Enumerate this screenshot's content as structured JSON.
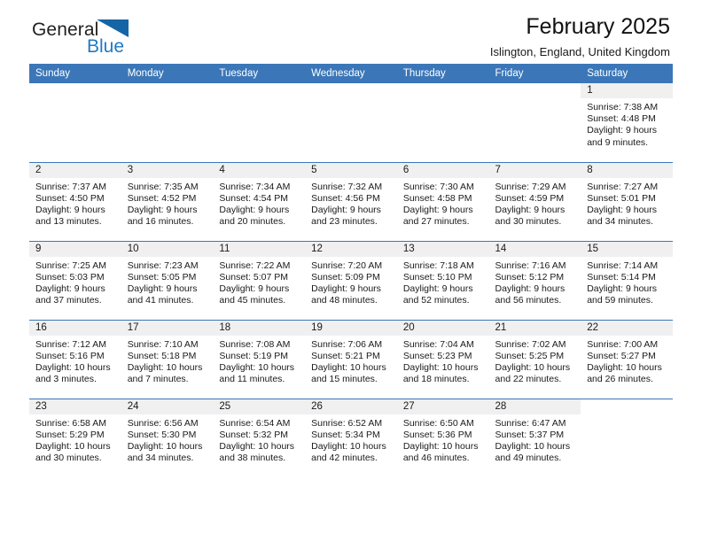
{
  "brand": {
    "name_part1": "General",
    "name_part2": "Blue",
    "logo_icon": "triangle-flag-icon",
    "accent_color": "#1f7ac4",
    "flag_color": "#1565a6"
  },
  "header": {
    "title": "February 2025",
    "subtitle": "Islington, England, United Kingdom"
  },
  "calendar": {
    "header_bg": "#3b77b8",
    "daynum_bg": "#f0f0f0",
    "weekdays": [
      "Sunday",
      "Monday",
      "Tuesday",
      "Wednesday",
      "Thursday",
      "Friday",
      "Saturday"
    ],
    "weeks": [
      [
        {
          "day": "",
          "sunrise": "",
          "sunset": "",
          "daylight": ""
        },
        {
          "day": "",
          "sunrise": "",
          "sunset": "",
          "daylight": ""
        },
        {
          "day": "",
          "sunrise": "",
          "sunset": "",
          "daylight": ""
        },
        {
          "day": "",
          "sunrise": "",
          "sunset": "",
          "daylight": ""
        },
        {
          "day": "",
          "sunrise": "",
          "sunset": "",
          "daylight": ""
        },
        {
          "day": "",
          "sunrise": "",
          "sunset": "",
          "daylight": ""
        },
        {
          "day": "1",
          "sunrise": "Sunrise: 7:38 AM",
          "sunset": "Sunset: 4:48 PM",
          "daylight": "Daylight: 9 hours and 9 minutes."
        }
      ],
      [
        {
          "day": "2",
          "sunrise": "Sunrise: 7:37 AM",
          "sunset": "Sunset: 4:50 PM",
          "daylight": "Daylight: 9 hours and 13 minutes."
        },
        {
          "day": "3",
          "sunrise": "Sunrise: 7:35 AM",
          "sunset": "Sunset: 4:52 PM",
          "daylight": "Daylight: 9 hours and 16 minutes."
        },
        {
          "day": "4",
          "sunrise": "Sunrise: 7:34 AM",
          "sunset": "Sunset: 4:54 PM",
          "daylight": "Daylight: 9 hours and 20 minutes."
        },
        {
          "day": "5",
          "sunrise": "Sunrise: 7:32 AM",
          "sunset": "Sunset: 4:56 PM",
          "daylight": "Daylight: 9 hours and 23 minutes."
        },
        {
          "day": "6",
          "sunrise": "Sunrise: 7:30 AM",
          "sunset": "Sunset: 4:58 PM",
          "daylight": "Daylight: 9 hours and 27 minutes."
        },
        {
          "day": "7",
          "sunrise": "Sunrise: 7:29 AM",
          "sunset": "Sunset: 4:59 PM",
          "daylight": "Daylight: 9 hours and 30 minutes."
        },
        {
          "day": "8",
          "sunrise": "Sunrise: 7:27 AM",
          "sunset": "Sunset: 5:01 PM",
          "daylight": "Daylight: 9 hours and 34 minutes."
        }
      ],
      [
        {
          "day": "9",
          "sunrise": "Sunrise: 7:25 AM",
          "sunset": "Sunset: 5:03 PM",
          "daylight": "Daylight: 9 hours and 37 minutes."
        },
        {
          "day": "10",
          "sunrise": "Sunrise: 7:23 AM",
          "sunset": "Sunset: 5:05 PM",
          "daylight": "Daylight: 9 hours and 41 minutes."
        },
        {
          "day": "11",
          "sunrise": "Sunrise: 7:22 AM",
          "sunset": "Sunset: 5:07 PM",
          "daylight": "Daylight: 9 hours and 45 minutes."
        },
        {
          "day": "12",
          "sunrise": "Sunrise: 7:20 AM",
          "sunset": "Sunset: 5:09 PM",
          "daylight": "Daylight: 9 hours and 48 minutes."
        },
        {
          "day": "13",
          "sunrise": "Sunrise: 7:18 AM",
          "sunset": "Sunset: 5:10 PM",
          "daylight": "Daylight: 9 hours and 52 minutes."
        },
        {
          "day": "14",
          "sunrise": "Sunrise: 7:16 AM",
          "sunset": "Sunset: 5:12 PM",
          "daylight": "Daylight: 9 hours and 56 minutes."
        },
        {
          "day": "15",
          "sunrise": "Sunrise: 7:14 AM",
          "sunset": "Sunset: 5:14 PM",
          "daylight": "Daylight: 9 hours and 59 minutes."
        }
      ],
      [
        {
          "day": "16",
          "sunrise": "Sunrise: 7:12 AM",
          "sunset": "Sunset: 5:16 PM",
          "daylight": "Daylight: 10 hours and 3 minutes."
        },
        {
          "day": "17",
          "sunrise": "Sunrise: 7:10 AM",
          "sunset": "Sunset: 5:18 PM",
          "daylight": "Daylight: 10 hours and 7 minutes."
        },
        {
          "day": "18",
          "sunrise": "Sunrise: 7:08 AM",
          "sunset": "Sunset: 5:19 PM",
          "daylight": "Daylight: 10 hours and 11 minutes."
        },
        {
          "day": "19",
          "sunrise": "Sunrise: 7:06 AM",
          "sunset": "Sunset: 5:21 PM",
          "daylight": "Daylight: 10 hours and 15 minutes."
        },
        {
          "day": "20",
          "sunrise": "Sunrise: 7:04 AM",
          "sunset": "Sunset: 5:23 PM",
          "daylight": "Daylight: 10 hours and 18 minutes."
        },
        {
          "day": "21",
          "sunrise": "Sunrise: 7:02 AM",
          "sunset": "Sunset: 5:25 PM",
          "daylight": "Daylight: 10 hours and 22 minutes."
        },
        {
          "day": "22",
          "sunrise": "Sunrise: 7:00 AM",
          "sunset": "Sunset: 5:27 PM",
          "daylight": "Daylight: 10 hours and 26 minutes."
        }
      ],
      [
        {
          "day": "23",
          "sunrise": "Sunrise: 6:58 AM",
          "sunset": "Sunset: 5:29 PM",
          "daylight": "Daylight: 10 hours and 30 minutes."
        },
        {
          "day": "24",
          "sunrise": "Sunrise: 6:56 AM",
          "sunset": "Sunset: 5:30 PM",
          "daylight": "Daylight: 10 hours and 34 minutes."
        },
        {
          "day": "25",
          "sunrise": "Sunrise: 6:54 AM",
          "sunset": "Sunset: 5:32 PM",
          "daylight": "Daylight: 10 hours and 38 minutes."
        },
        {
          "day": "26",
          "sunrise": "Sunrise: 6:52 AM",
          "sunset": "Sunset: 5:34 PM",
          "daylight": "Daylight: 10 hours and 42 minutes."
        },
        {
          "day": "27",
          "sunrise": "Sunrise: 6:50 AM",
          "sunset": "Sunset: 5:36 PM",
          "daylight": "Daylight: 10 hours and 46 minutes."
        },
        {
          "day": "28",
          "sunrise": "Sunrise: 6:47 AM",
          "sunset": "Sunset: 5:37 PM",
          "daylight": "Daylight: 10 hours and 49 minutes."
        },
        {
          "day": "",
          "sunrise": "",
          "sunset": "",
          "daylight": ""
        }
      ]
    ]
  }
}
